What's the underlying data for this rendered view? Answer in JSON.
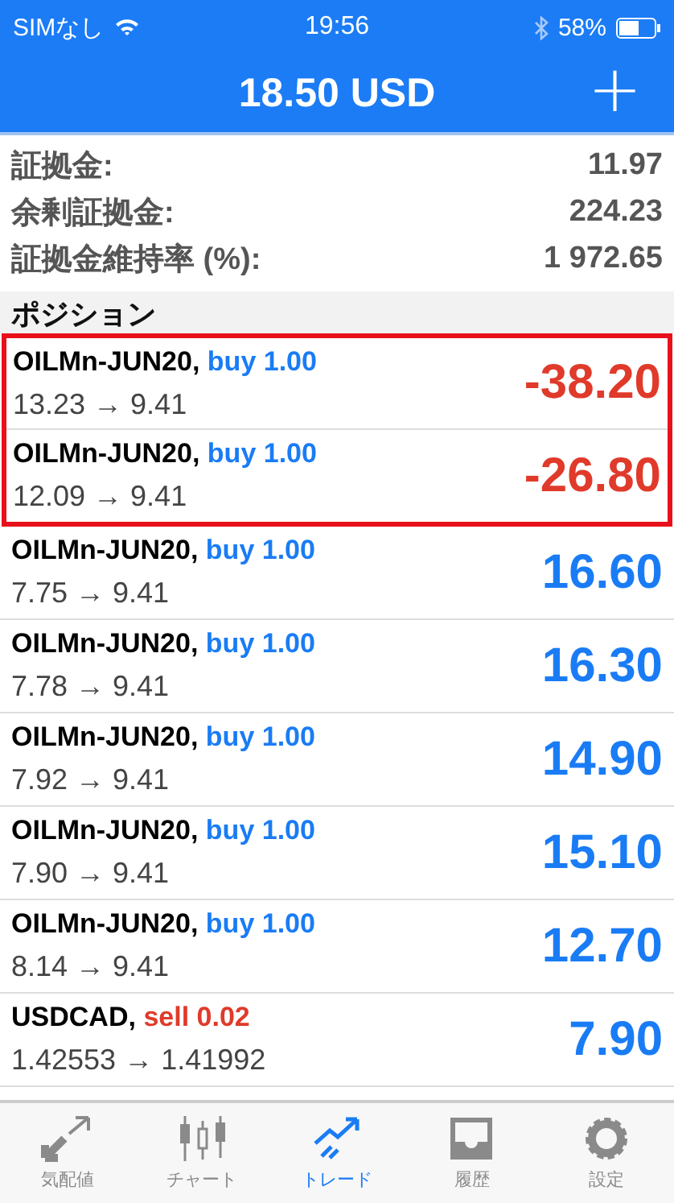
{
  "status_bar": {
    "carrier": "SIMなし",
    "time": "19:56",
    "battery": "58%"
  },
  "header": {
    "title": "18.50 USD",
    "add_button": "+"
  },
  "summary": [
    {
      "label": "証拠金:",
      "value": "11.97"
    },
    {
      "label": "余剰証拠金:",
      "value": "224.23"
    },
    {
      "label": "証拠金維持率 (%):",
      "value": "1 972.65"
    }
  ],
  "section_title": "ポジション",
  "positions": [
    {
      "symbol": "OILMn-JUN20,",
      "side": "buy 1.00",
      "kind": "buy",
      "prices": "13.23 → 9.41",
      "profit": "-38.20",
      "loss": true,
      "highlighted": true
    },
    {
      "symbol": "OILMn-JUN20,",
      "side": "buy 1.00",
      "kind": "buy",
      "prices": "12.09 → 9.41",
      "profit": "-26.80",
      "loss": true,
      "highlighted": true
    },
    {
      "symbol": "OILMn-JUN20,",
      "side": "buy 1.00",
      "kind": "buy",
      "prices": "7.75 → 9.41",
      "profit": "16.60",
      "loss": false,
      "highlighted": false
    },
    {
      "symbol": "OILMn-JUN20,",
      "side": "buy 1.00",
      "kind": "buy",
      "prices": "7.78 → 9.41",
      "profit": "16.30",
      "loss": false,
      "highlighted": false
    },
    {
      "symbol": "OILMn-JUN20,",
      "side": "buy 1.00",
      "kind": "buy",
      "prices": "7.92 → 9.41",
      "profit": "14.90",
      "loss": false,
      "highlighted": false
    },
    {
      "symbol": "OILMn-JUN20,",
      "side": "buy 1.00",
      "kind": "buy",
      "prices": "7.90 → 9.41",
      "profit": "15.10",
      "loss": false,
      "highlighted": false
    },
    {
      "symbol": "OILMn-JUN20,",
      "side": "buy 1.00",
      "kind": "buy",
      "prices": "8.14 → 9.41",
      "profit": "12.70",
      "loss": false,
      "highlighted": false
    },
    {
      "symbol": "USDCAD,",
      "side": "sell 0.02",
      "kind": "sell",
      "prices": "1.42553 → 1.41992",
      "profit": "7.90",
      "loss": false,
      "highlighted": false
    }
  ],
  "tabs": [
    {
      "label": "気配値",
      "kind": "quotes",
      "selected": false
    },
    {
      "label": "チャート",
      "kind": "chart",
      "selected": false
    },
    {
      "label": "トレード",
      "kind": "trade",
      "selected": true
    },
    {
      "label": "履歴",
      "kind": "history",
      "selected": false
    },
    {
      "label": "設定",
      "kind": "settings",
      "selected": false
    }
  ]
}
